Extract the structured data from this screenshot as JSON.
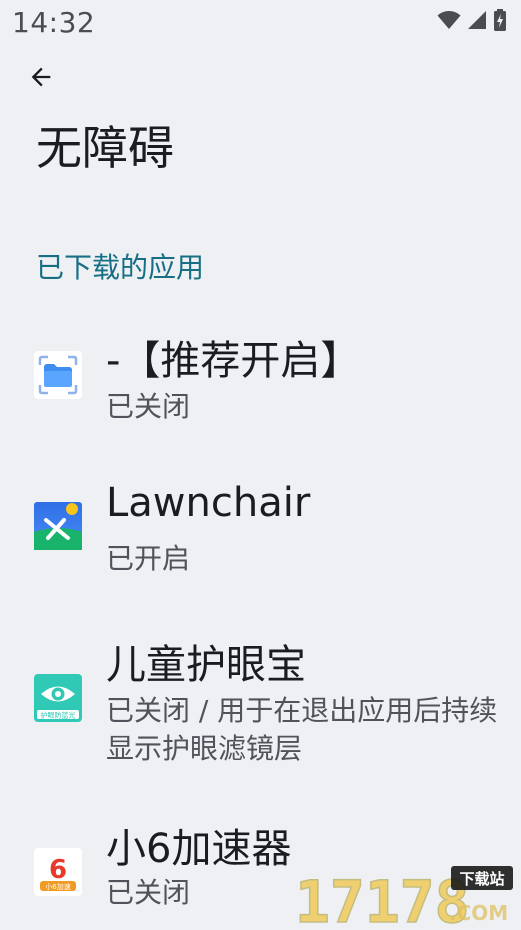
{
  "status_bar": {
    "time": "14:32",
    "icons": [
      "wifi-icon",
      "cellular-signal-icon",
      "battery-charging-icon"
    ]
  },
  "toolbar": {
    "back_icon": "arrow-back-icon"
  },
  "page": {
    "title": "无障碍"
  },
  "section": {
    "header": "已下载的应用"
  },
  "apps": [
    {
      "title": "-【推荐开启】",
      "summary": "已关闭",
      "icon": "blue-folder-scan-icon"
    },
    {
      "title": "Lawnchair",
      "summary": "已开启",
      "icon": "lawnchair-icon"
    },
    {
      "title": "儿童护眼宝",
      "summary": "已关闭 / 用于在退出应用后持续显示护眼滤镜层",
      "icon": "eye-protection-icon",
      "icon_label": "护眼防蓝光"
    },
    {
      "title": "小6加速器",
      "summary": "已关闭",
      "icon": "xiao6-accelerator-icon",
      "icon_label": "小6加速"
    }
  ],
  "watermark": {
    "number": "17178",
    "suffix": ".COM",
    "tag": "下载站"
  },
  "colors": {
    "background": "#eef0f4",
    "accent": "#166f84",
    "title_text": "#1b1c1f",
    "summary_text": "#50535a"
  }
}
